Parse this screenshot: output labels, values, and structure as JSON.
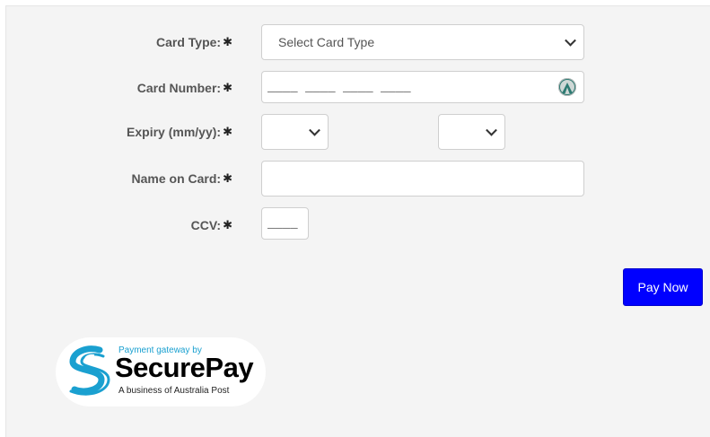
{
  "form": {
    "card_type": {
      "label": "Card Type:",
      "required_mark": "✱",
      "selected": "Select Card Type"
    },
    "card_number": {
      "label": "Card Number:",
      "required_mark": "✱",
      "value": "____ ____ ____ ____"
    },
    "expiry": {
      "label": "Expiry (mm/yy):",
      "required_mark": "✱",
      "month_selected": "",
      "year_selected": ""
    },
    "name_on_card": {
      "label": "Name on Card:",
      "required_mark": "✱",
      "value": ""
    },
    "ccv": {
      "label": "CCV:",
      "required_mark": "✱",
      "value": "____"
    }
  },
  "pay_button": {
    "label": "Pay Now"
  },
  "securepay_badge": {
    "tagline": "Payment gateway by",
    "brand": "SecurePay",
    "subtitle": "A business of Australia Post"
  },
  "colors": {
    "panel_bg": "#f4f4f4",
    "button_bg": "#0000ff",
    "label_text": "#555555",
    "brand_blue": "#1aa0d0"
  },
  "icons": {
    "autofill": "card-autofill-icon",
    "dropdown": "chevron-down-icon",
    "brand_logo": "securepay-s-logo"
  }
}
